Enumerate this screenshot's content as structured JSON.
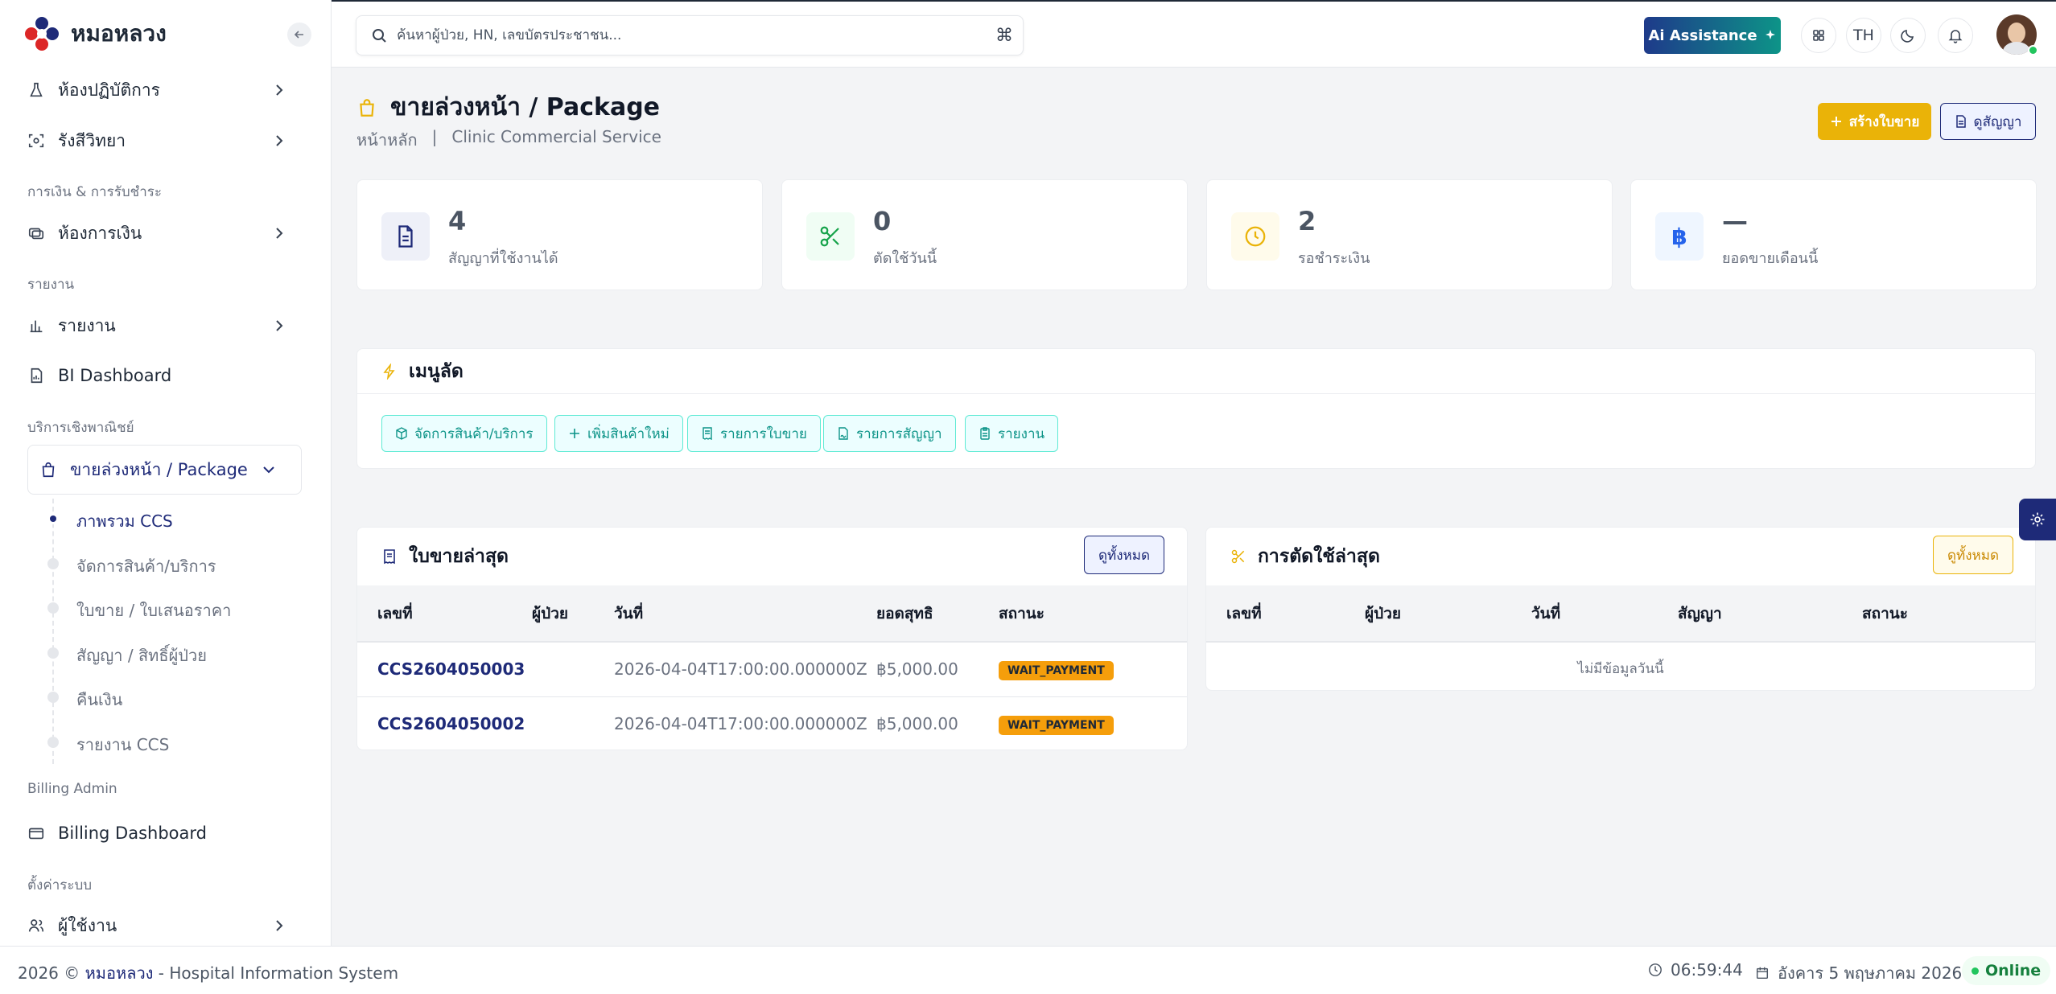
{
  "app": {
    "name": "หมอหลวง"
  },
  "sidebar": {
    "items": [
      {
        "label": "ห้องปฏิบัติการ"
      },
      {
        "label": "รังสีวิทยา"
      },
      {
        "label": "ห้องการเงิน"
      },
      {
        "label": "รายงาน"
      },
      {
        "label": "BI Dashboard"
      },
      {
        "label": "ขายล่วงหน้า / Package"
      },
      {
        "label": "Billing Dashboard"
      },
      {
        "label": "ผู้ใช้งาน"
      }
    ],
    "sections": [
      "การเงิน & การรับชำระ",
      "รายงาน",
      "บริการเชิงพาณิชย์",
      "Billing Admin",
      "ตั้งค่าระบบ"
    ],
    "subitems": [
      {
        "label": "ภาพรวม CCS"
      },
      {
        "label": "จัดการสินค้า/บริการ"
      },
      {
        "label": "ใบขาย / ใบเสนอราคา"
      },
      {
        "label": "สัญญา / สิทธิ์ผู้ป่วย"
      },
      {
        "label": "คืนเงิน"
      },
      {
        "label": "รายงาน CCS"
      }
    ]
  },
  "topbar": {
    "search_placeholder": "ค้นหาผู้ป่วย, HN, เลขบัตรประชาชน...",
    "ai_label": "Ai Assistance",
    "lang": "TH"
  },
  "page": {
    "title": "ขายล่วงหน้า / Package",
    "breadcrumb": [
      "หน้าหลัก",
      "|",
      "Clinic Commercial Service"
    ],
    "create_label": "สร้างใบขาย",
    "contract_label": "ดูสัญญา"
  },
  "stats": [
    {
      "value": "4",
      "label": "สัญญาที่ใช้งานได้",
      "color": "#1e2a78",
      "bg": "#eef0f8"
    },
    {
      "value": "0",
      "label": "ตัดใช้วันนี้",
      "color": "#16a34a",
      "bg": "#f0fdf4"
    },
    {
      "value": "2",
      "label": "รอชำระเงิน",
      "color": "#eab308",
      "bg": "#fffbeb"
    },
    {
      "value": "—",
      "label": "ยอดขายเดือนนี้",
      "color": "#2563eb",
      "bg": "#eff6ff"
    }
  ],
  "shortcuts": {
    "title": "เมนูลัด",
    "buttons": [
      "จัดการสินค้า/บริการ",
      "เพิ่มสินค้าใหม่",
      "รายการใบขาย",
      "รายการสัญญา",
      "รายงาน"
    ]
  },
  "latest_sales": {
    "title": "ใบขายล่าสุด",
    "view_all": "ดูทั้งหมด",
    "columns": [
      "เลขที่",
      "ผู้ป่วย",
      "วันที่",
      "ยอดสุทธิ",
      "สถานะ"
    ],
    "rows": [
      {
        "no": "CCS2604050003",
        "patient": "",
        "date": "2026-04-04T17:00:00.000000Z",
        "amount": "฿5,000.00",
        "status": "WAIT_PAYMENT"
      },
      {
        "no": "CCS2604050002",
        "patient": "",
        "date": "2026-04-04T17:00:00.000000Z",
        "amount": "฿5,000.00",
        "status": "WAIT_PAYMENT"
      }
    ]
  },
  "latest_usage": {
    "title": "การตัดใช้ล่าสุด",
    "view_all": "ดูทั้งหมด",
    "columns": [
      "เลขที่",
      "ผู้ป่วย",
      "วันที่",
      "สัญญา",
      "สถานะ"
    ],
    "empty": "ไม่มีข้อมูลวันนี้"
  },
  "footer": {
    "year": "2026 ©",
    "brand": "หมอหลวง",
    "suffix": " - Hospital Information System",
    "time": "06:59:44",
    "date": "อังคาร 5 พฤษภาคม 2026",
    "status": "Online"
  },
  "colors": {
    "primary": "#1e2a78",
    "accent": "#eab308",
    "teal": "#0d9488",
    "online": "#22c55e"
  }
}
